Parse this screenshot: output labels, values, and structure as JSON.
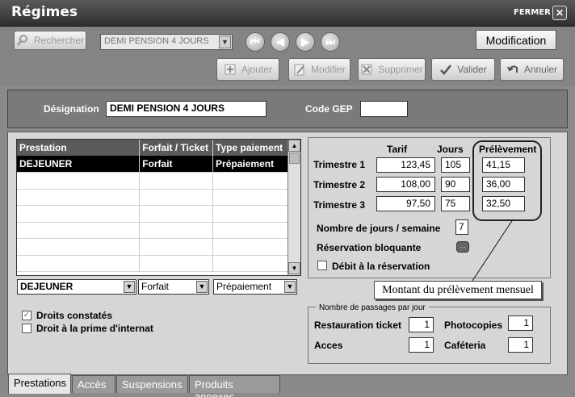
{
  "window": {
    "title": "Régimes",
    "close_label": "FERMER",
    "close_glyph": "✕"
  },
  "toolbar": {
    "search_label": "Rechercher",
    "regime_selected": "DEMI PENSION 4 JOURS",
    "nav": [
      "⏮",
      "◀",
      "▶",
      "⏭"
    ],
    "mode_label": "Modification",
    "add_label": "Ajouter",
    "edit_label": "Modifier",
    "delete_label": "Supprimer",
    "validate_label": "Valider",
    "cancel_label": "Annuler"
  },
  "designation": {
    "label": "Désignation",
    "value": "DEMI PENSION 4 JOURS",
    "code_label": "Code GEP",
    "code_value": ""
  },
  "grid": {
    "columns": [
      "Prestation",
      "Forfait / Ticket",
      "Type paiement"
    ],
    "rows": [
      [
        "DEJEUNER",
        "Forfait",
        "Prépaiement"
      ]
    ],
    "empty_rows": 6,
    "edit_prestation": "DEJEUNER",
    "edit_forfait": "Forfait",
    "edit_paiement": "Prépaiement"
  },
  "options": {
    "droits_label": "Droits constatés",
    "droits_checked": true,
    "prime_label": "Droit à la prime d'internat",
    "prime_checked": false
  },
  "tarifs": {
    "col_tarif": "Tarif",
    "col_jours": "Jours",
    "col_prelevement": "Prélèvement",
    "rows": [
      {
        "label": "Trimestre 1",
        "tarif": "123,45",
        "jours": "105",
        "prelevement": "41,15"
      },
      {
        "label": "Trimestre 2",
        "tarif": "108,00",
        "jours": "90",
        "prelevement": "36,00"
      },
      {
        "label": "Trimestre 3",
        "tarif": "97,50",
        "jours": "75",
        "prelevement": "32,50"
      }
    ],
    "jours_semaine_label": "Nombre de jours / semaine",
    "jours_semaine": "7",
    "reservation_label": "Réservation bloquante",
    "reservation_btn": "...",
    "debit_label": "Débit à la réservation"
  },
  "callout": "Montant du prélèvement mensuel",
  "passages": {
    "legend": "Nombre de passages par jour",
    "restauration_label": "Restauration ticket",
    "restauration": "1",
    "photocopies_label": "Photocopies",
    "photocopies": "1",
    "acces_label": "Acces",
    "acces": "1",
    "cafeteria_label": "Caféteria",
    "cafeteria": "1"
  },
  "tabs": [
    "Prestations",
    "Accès",
    "Suspensions",
    "Produits annexes"
  ]
}
